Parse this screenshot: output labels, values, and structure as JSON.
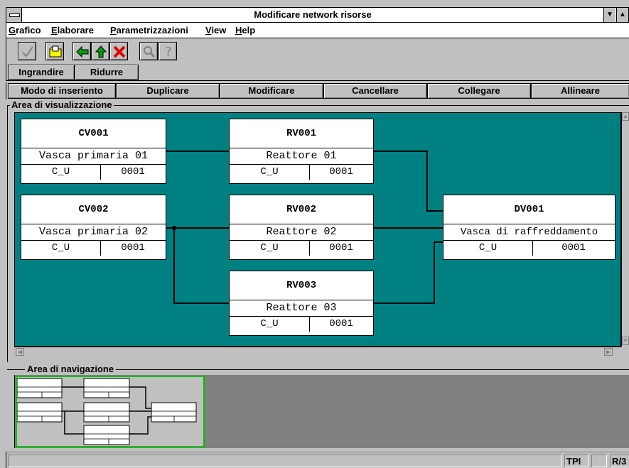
{
  "window": {
    "title": "Modificare network risorse"
  },
  "menu": [
    {
      "label": "Grafico",
      "accel": "G",
      "rest": "rafico"
    },
    {
      "label": "Elaborare",
      "accel": "E",
      "rest": "laborare"
    },
    {
      "label": "Parametrizzazioni",
      "accel": "P",
      "rest": "arametrizzazioni"
    },
    {
      "label": "View",
      "accel": "V",
      "rest": "iew"
    },
    {
      "label": "Help",
      "accel": "H",
      "rest": "elp"
    }
  ],
  "toolbar": {
    "icons": [
      "check-icon",
      "open-folder-icon",
      "back-arrow-icon",
      "up-arrow-icon",
      "delete-x-icon",
      "zoom-icon",
      "help-icon"
    ]
  },
  "zoom": {
    "enlarge": "Ingrandire",
    "reduce": "Ridurre"
  },
  "modes": [
    "Modo di inseriento",
    "Duplicare",
    "Modificare",
    "Cancellare",
    "Collegare",
    "Allineare"
  ],
  "visual_area": {
    "label": "Area di visualizzazione"
  },
  "nav_area": {
    "label": "Area di navigazione"
  },
  "nodes": [
    {
      "id": "CV001",
      "desc": "Vasca primaria 01",
      "code": "C_U",
      "num": "0001"
    },
    {
      "id": "RV001",
      "desc": "Reattore 01",
      "code": "C_U",
      "num": "0001"
    },
    {
      "id": "CV002",
      "desc": "Vasca primaria 02",
      "code": "C_U",
      "num": "0001"
    },
    {
      "id": "RV002",
      "desc": "Reattore 02",
      "code": "C_U",
      "num": "0001"
    },
    {
      "id": "DV001",
      "desc": "Vasca di raffreddamento",
      "code": "C_U",
      "num": "0001"
    },
    {
      "id": "RV003",
      "desc": "Reattore 03",
      "code": "C_U",
      "num": "0001"
    }
  ],
  "status": {
    "cell1": "TPI",
    "cell2": "R/3"
  },
  "colors": {
    "canvas": "#008080",
    "nav_highlight": "#00c000",
    "chrome": "#c0c0c0"
  }
}
